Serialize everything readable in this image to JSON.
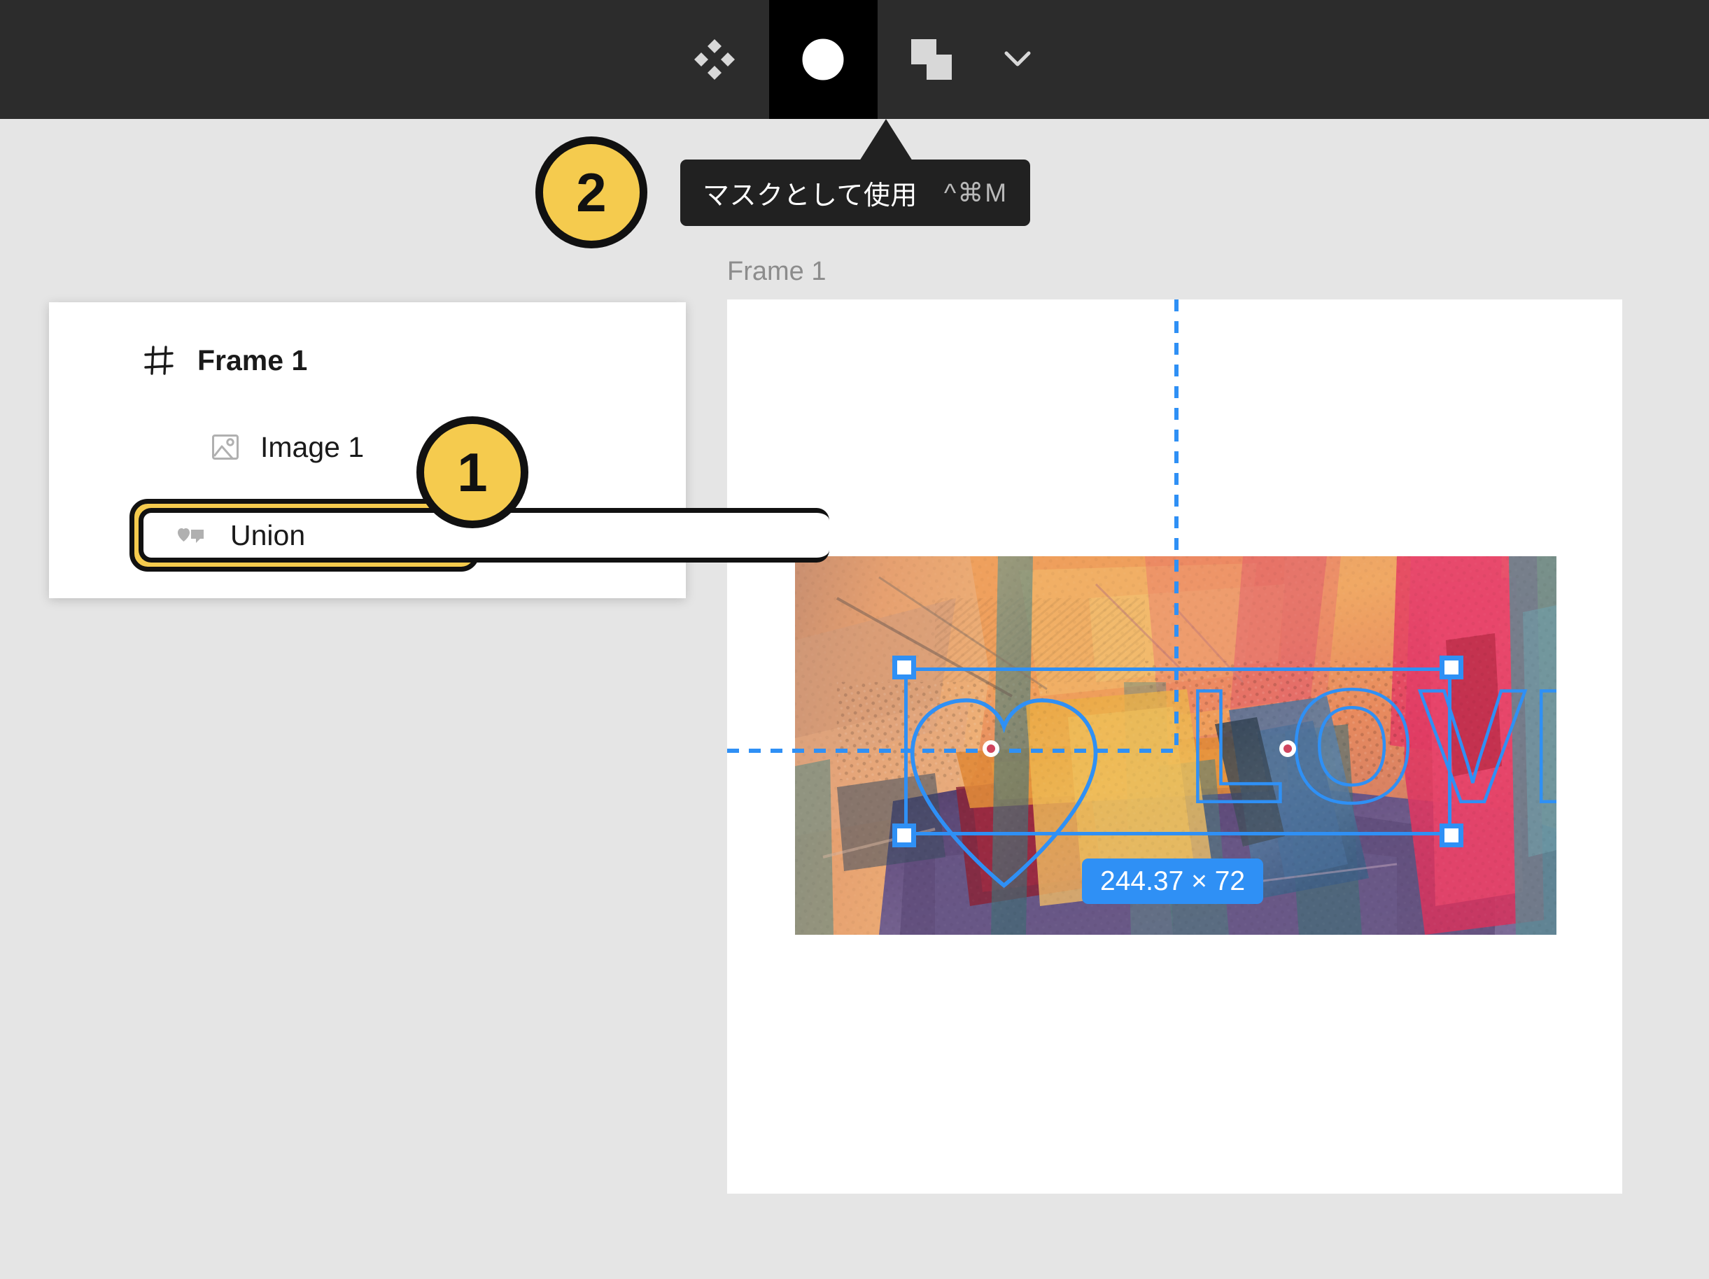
{
  "toolbar": {
    "background": "#2c2c2c",
    "active_background": "#000000",
    "buttons": [
      {
        "name": "components-icon",
        "label": "Components",
        "active": false
      },
      {
        "name": "mask-icon",
        "label": "Use as mask",
        "active": true
      },
      {
        "name": "boolean-groups-icon",
        "label": "Boolean groups",
        "active": false
      }
    ],
    "dropdown_caret": "chevron-down-icon"
  },
  "tooltip": {
    "label": "マスクとして使用",
    "shortcut": "^⌘M",
    "background": "#212121",
    "text_color": "#ffffff",
    "shortcut_color": "#b9b9b9"
  },
  "callouts": [
    {
      "id": "1",
      "number": "1",
      "target": "union-layer-row",
      "fill": "#f5cb4e",
      "stroke": "#111111"
    },
    {
      "id": "2",
      "number": "2",
      "target": "mask-toolbar-button",
      "fill": "#f5cb4e",
      "stroke": "#111111"
    }
  ],
  "layers_panel": {
    "background": "#ffffff",
    "rows": [
      {
        "name": "frame-1",
        "label": "Frame 1",
        "icon": "frame-icon",
        "bold": true,
        "indent": 0,
        "selected": false
      },
      {
        "name": "image-1",
        "label": "Image 1",
        "icon": "image-icon",
        "bold": false,
        "indent": 1,
        "selected": false
      },
      {
        "name": "union",
        "label": "Union",
        "icon": "union-boolean-icon",
        "bold": false,
        "indent": 1,
        "selected": true
      }
    ]
  },
  "canvas": {
    "frame_label": "Frame 1",
    "frame_label_color": "#8c8c8c",
    "frame_background": "#ffffff",
    "page_background": "#e5e5e5",
    "selection": {
      "color": "#2f90f5",
      "size_badge": "244.37 × 72",
      "width": "244.37",
      "height": "72",
      "handles": [
        "top-left",
        "top-right",
        "bottom-left",
        "bottom-right"
      ]
    },
    "guides": {
      "color": "#2f90f5",
      "style": "dashed",
      "vertical": true,
      "horizontal": true
    },
    "vector_shapes": [
      {
        "name": "heart-shape",
        "outline_color": "#2f90f5"
      },
      {
        "name": "love-text",
        "text": "LOVE",
        "outline_color": "#2f90f5"
      }
    ],
    "artwork": {
      "name": "abstract-painting",
      "description": "Abstract palette-knife painting, orange / red / purple / teal"
    }
  }
}
